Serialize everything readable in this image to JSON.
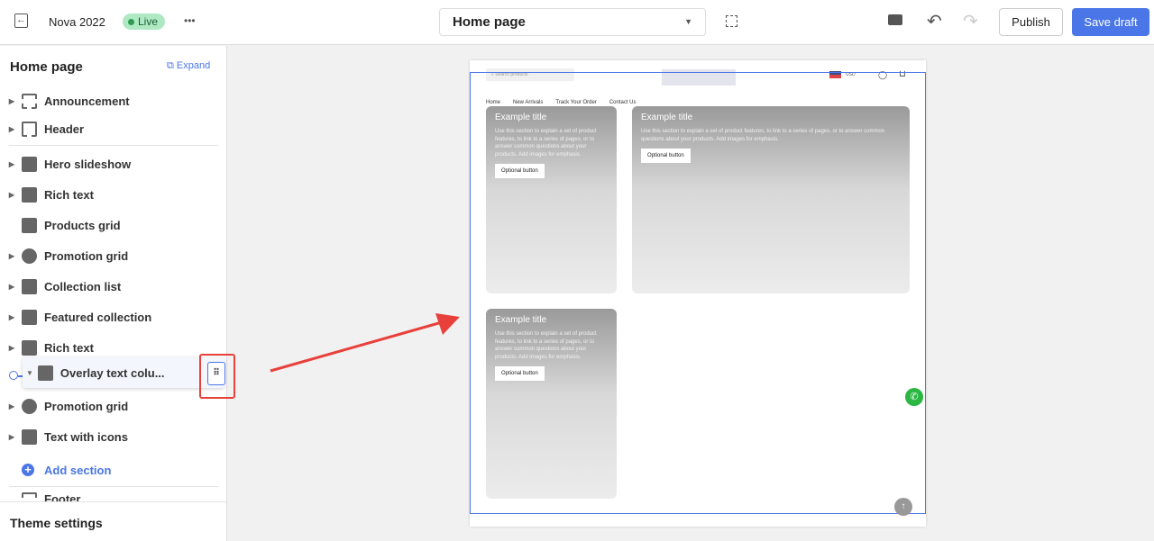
{
  "topbar": {
    "exit_icon": "exit-icon",
    "theme_name": "Nova 2022",
    "status": "Live",
    "more": "•••",
    "page_select": "Home page",
    "publish": "Publish",
    "save": "Save draft"
  },
  "sidebar": {
    "title": "Home page",
    "expand": "Expand",
    "items": [
      {
        "label": "Announcement",
        "icon": "announcement-icon"
      },
      {
        "label": "Header",
        "icon": "header-icon"
      },
      {
        "label": "Hero slideshow",
        "icon": "image-icon"
      },
      {
        "label": "Rich text",
        "icon": "document-icon"
      },
      {
        "label": "Products grid",
        "icon": "products-icon"
      },
      {
        "label": "Promotion grid",
        "icon": "percent-icon"
      },
      {
        "label": "Collection list",
        "icon": "tag-icon"
      },
      {
        "label": "Featured collection",
        "icon": "tag-icon"
      },
      {
        "label": "Rich text",
        "icon": "document-icon"
      },
      {
        "label": "Overlay text colu...",
        "icon": "document-icon"
      },
      {
        "label": "Promotion grid",
        "icon": "percent-icon"
      },
      {
        "label": "Text with icons",
        "icon": "document-icon"
      }
    ],
    "add_section": "Add section",
    "footer": "Footer",
    "theme_settings": "Theme settings"
  },
  "preview": {
    "search_placeholder": "Search products",
    "currency": "USD",
    "nav": [
      "Home",
      "New Arrivals",
      "Track Your Order",
      "Contact Us"
    ],
    "card_title": "Example title",
    "card_text": "Use this section to explain a set of product features, to link to a series of pages, or to answer common questions about your products. Add images for emphasis.",
    "card_button": "Optional button"
  },
  "colors": {
    "accent": "#4a76e8",
    "annotation": "#e8413c",
    "live": "#aee9c4"
  }
}
